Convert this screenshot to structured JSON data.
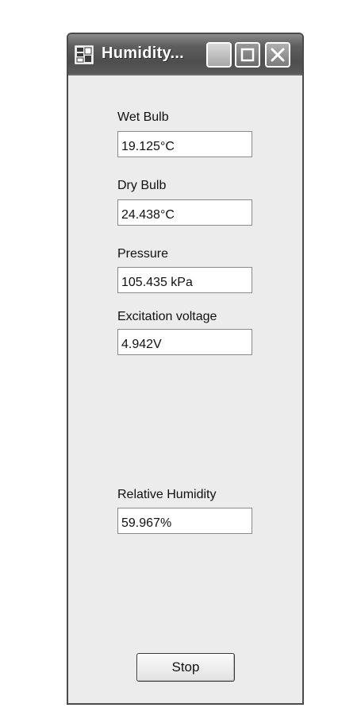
{
  "window": {
    "title": "Humidity..."
  },
  "titlebar_icons": {
    "app": "application-icon",
    "minimize": "minimize-icon",
    "maximize": "maximize-icon",
    "close": "close-icon"
  },
  "fields": {
    "wet_bulb": {
      "label": "Wet Bulb",
      "value": "19.125°C"
    },
    "dry_bulb": {
      "label": "Dry Bulb",
      "value": "24.438°C"
    },
    "pressure": {
      "label": "Pressure",
      "value": "105.435 kPa"
    },
    "excitation_voltage": {
      "label": "Excitation voltage",
      "value": "4.942V"
    },
    "relative_humidity": {
      "label": "Relative Humidity",
      "value": "59.967%"
    }
  },
  "buttons": {
    "stop_label": "Stop"
  },
  "colors": {
    "window_background": "#ececec",
    "titlebar": "#5a5a5a",
    "text": "#111111"
  }
}
